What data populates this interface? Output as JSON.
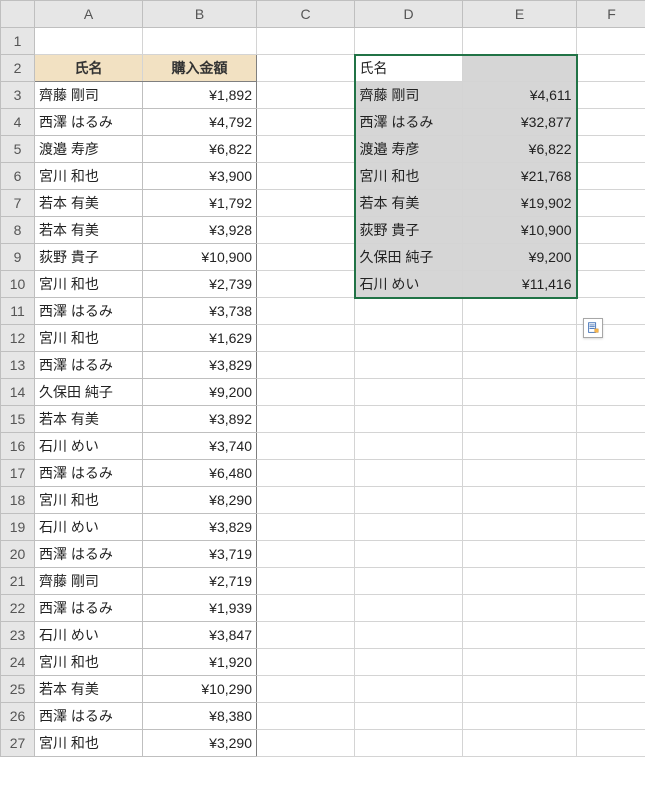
{
  "columnHeaders": [
    "A",
    "B",
    "C",
    "D",
    "E",
    "F"
  ],
  "rowNumbers": [
    "1",
    "2",
    "3",
    "4",
    "5",
    "6",
    "7",
    "8",
    "9",
    "10",
    "11",
    "12",
    "13",
    "14",
    "15",
    "16",
    "17",
    "18",
    "19",
    "20",
    "21",
    "22",
    "23",
    "24",
    "25",
    "26",
    "27"
  ],
  "tableAB": {
    "nameHeader": "氏名",
    "amountHeader": "購入金額",
    "rows": [
      {
        "name": "齊藤 剛司",
        "amount": "¥1,892"
      },
      {
        "name": "西澤 はるみ",
        "amount": "¥4,792"
      },
      {
        "name": "渡邉 寿彦",
        "amount": "¥6,822"
      },
      {
        "name": "宮川 和也",
        "amount": "¥3,900"
      },
      {
        "name": "若本 有美",
        "amount": "¥1,792"
      },
      {
        "name": "若本 有美",
        "amount": "¥3,928"
      },
      {
        "name": "荻野 貴子",
        "amount": "¥10,900"
      },
      {
        "name": "宮川 和也",
        "amount": "¥2,739"
      },
      {
        "name": "西澤 はるみ",
        "amount": "¥3,738"
      },
      {
        "name": "宮川 和也",
        "amount": "¥1,629"
      },
      {
        "name": "西澤 はるみ",
        "amount": "¥3,829"
      },
      {
        "name": "久保田 純子",
        "amount": "¥9,200"
      },
      {
        "name": "若本 有美",
        "amount": "¥3,892"
      },
      {
        "name": "石川 めい",
        "amount": "¥3,740"
      },
      {
        "name": "西澤 はるみ",
        "amount": "¥6,480"
      },
      {
        "name": "宮川 和也",
        "amount": "¥8,290"
      },
      {
        "name": "石川 めい",
        "amount": "¥3,829"
      },
      {
        "name": "西澤 はるみ",
        "amount": "¥3,719"
      },
      {
        "name": "齊藤 剛司",
        "amount": "¥2,719"
      },
      {
        "name": "西澤 はるみ",
        "amount": "¥1,939"
      },
      {
        "name": "石川 めい",
        "amount": "¥3,847"
      },
      {
        "name": "宮川 和也",
        "amount": "¥1,920"
      },
      {
        "name": "若本 有美",
        "amount": "¥10,290"
      },
      {
        "name": "西澤 はるみ",
        "amount": "¥8,380"
      },
      {
        "name": "宮川 和也",
        "amount": "¥3,290"
      }
    ]
  },
  "tableDE": {
    "nameHeader": "氏名",
    "amountHeader": "",
    "rows": [
      {
        "name": "齊藤 剛司",
        "amount": "¥4,611"
      },
      {
        "name": "西澤 はるみ",
        "amount": "¥32,877"
      },
      {
        "name": "渡邉 寿彦",
        "amount": "¥6,822"
      },
      {
        "name": "宮川 和也",
        "amount": "¥21,768"
      },
      {
        "name": "若本 有美",
        "amount": "¥19,902"
      },
      {
        "name": "荻野 貴子",
        "amount": "¥10,900"
      },
      {
        "name": "久保田 純子",
        "amount": "¥9,200"
      },
      {
        "name": "石川 めい",
        "amount": "¥11,416"
      }
    ]
  },
  "icons": {
    "smartTag": "smart-tag-icon"
  }
}
